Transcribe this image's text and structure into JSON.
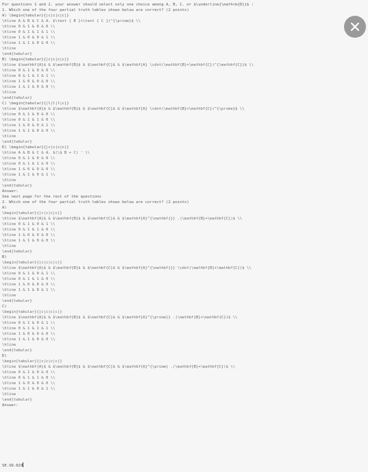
{
  "lines": [
    "For questions 1 and 2. your answer should select only one choice among A, B, C. or $\\underline{\\mathrm{D}}$ :",
    "1. Which one of the four partial truth tables shown below are correct? (2 points)",
    "A) \\begin{tabular}{|c|c|c|c|}",
    "\\hline A & B & C & A. $\\text { B }+\\text { C })^{\\prime}$ \\\\",
    "\\hline 0 & 1 & 0 & 0 \\\\",
    "\\hline 0 & 1 & 1 & 1 \\\\",
    "\\hline 1 & 0 & 0 & 1 \\\\",
    "\\hline 1 & 1 & 0 & 0 \\\\",
    "\\hline",
    "\\end{tabular}",
    "B) \\begin{tabular}{|c|c|c|c|}",
    "\\hline $\\mathbf{A}$ & $\\mathbf{B}$ & $\\mathbf{C}$ & $\\mathbf{A} \\cdot(\\mathbf{B}+\\mathbf{C})^{\\mathbf{C}}$ \\\\",
    "\\hline 0 & 1 & 0 & 0 \\\\",
    "\\hline 0 & 1 & 1 & 1 \\\\",
    "\\hline 1 & 0 & 0 & 0 \\\\",
    "\\hline 1 & 1 & 0 & 0 \\\\",
    "\\hline",
    "\\end{tabular}",
    "C) \\begin{tabular}{|l|l|l|c|}",
    "\\hline $\\mathbf{A}$ & $\\mathbf{B}$ & $\\mathbf{C}$ & $\\mathbf{A} \\cdot(\\mathbf{B}+\\mathbf{C})^{\\prime}$ \\\\",
    "\\hline 0 & 1 & 0 & 0 \\\\",
    "\\hline 0 & 1 & 1 & 0 \\\\",
    "\\hline 1 & 0 & 0 & 1 \\\\",
    "\\hline 1 & 1 & 0 & 0 \\\\",
    "\\hline",
    "\\end{tabular}",
    "D) \\begin{tabular}{|c|c|c|c|}",
    "\\hline A & B & C & A. $(\\$ B + C) ' \\\\",
    "\\hline 0 & 1 & 0 & 0 \\\\",
    "\\hline 0 & 1 & 1 & 0 \\\\",
    "\\hline 1 & 0 & 0 & 0 \\\\",
    "\\hline 1 & 1 & 0 & 1 \\\\",
    "\\hline",
    "\\end{tabular}",
    "Answer:",
    "See next page for the rest of the questions",
    "2. Which one of the four partial truth tables shown below are correct? (2 points)",
    "A)",
    "\\begin{tabular}{|c|c|c|c|}",
    "\\hline $\\mathbf{A}$ & $\\mathbf{B}$ & $\\mathbf{C}$ & $\\mathbf{A}^{\\mathbf{}} .(\\mathbf{B}+\\mathbf{C})$ \\\\",
    "\\hline 0 & 1 & 0 & 1 \\\\",
    "\\hline 0 & 1 & 1 & 0 \\\\",
    "\\hline 1 & 0 & 0 & 0 \\\\",
    "\\hline 1 & 1 & 0 & 0 \\\\",
    "\\hline",
    "\\end{tabular}",
    "B)",
    "\\begin{tabular}{|c|c|c|c|}",
    "\\hline $\\mathbf{A}$ & $\\mathbf{B}$ & $\\mathbf{C}$ & $\\mathbf{A}^{\\mathbf{}} \\cdot(\\mathbf{B}+\\mathbf{C})$ \\\\",
    "\\hline 0 & 1 & 0 & 1 \\\\",
    "\\hline 0 & 1 & 1 & 0 \\\\",
    "\\hline 1 & 0 & 0 & 0 \\\\",
    "\\hline 1 & 1 & 0 & 1 \\\\",
    "\\hline",
    "\\end{tabular}",
    "C)",
    "\\begin{tabular}{|c|c|c|c|}",
    "\\hline $\\mathbf{A}$ & $\\mathbf{B}$ & $\\mathbf{C}$ & $\\mathbf{A}^{\\prime}} .(\\mathbf{B}+\\mathbf{C})$ \\\\",
    "\\hline 0 & 1 & 0 & 1 \\\\",
    "\\hline 0 & 1 & 1 & 1 \\\\",
    "\\hline 1 & 0 & 0 & 0 \\\\",
    "\\hline 1 & 1 & 0 & 0 \\\\",
    "\\hline",
    "\\end{tabular}",
    "D)",
    "\\begin{tabular}{|c|c|c|c|}",
    "\\hline $\\mathbf{A}$ & $\\mathbf{B}$ & $\\mathbf{C}$ & $\\mathbf{A}^{\\prime} .(\\mathbf{B}+\\mathbf{C})$ \\\\",
    "\\hline 0 & 1 & 0 & 0 \\\\",
    "\\hline 0 & 1 & 1 & 0 \\\\",
    "\\hline 1 & 0 & 0 & 0 \\\\",
    "\\hline 1 & 1 & 0 & 1 \\\\",
    "\\hline",
    "\\end{tabular}",
    "Answer:"
  ],
  "answer_input": {
    "value": "SE.SD.029"
  },
  "close_button": {
    "icon": "close-icon",
    "color": "#9a9a9a"
  }
}
